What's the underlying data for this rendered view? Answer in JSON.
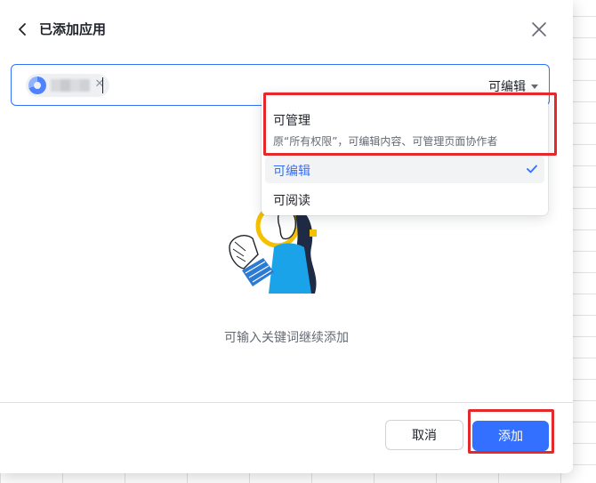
{
  "dialog": {
    "title": "已添加应用",
    "icons": {
      "back": "chevron-left-icon",
      "close": "close-icon"
    }
  },
  "search": {
    "selected_chip": {
      "icon": "app-avatar-icon",
      "label_redacted": true
    },
    "permission_selected": "可编辑"
  },
  "dropdown": {
    "items": [
      {
        "label": "可管理",
        "description": "原“所有权限”，可编辑内容、可管理页面协作者",
        "selected": false
      },
      {
        "label": "可编辑",
        "description": "",
        "selected": true
      },
      {
        "label": "可阅读",
        "description": "",
        "selected": false
      }
    ]
  },
  "empty_state": {
    "hint": "可输入关键词继续添加"
  },
  "footer": {
    "cancel_label": "取消",
    "add_label": "添加"
  },
  "colors": {
    "primary": "#3370ff",
    "highlight": "#e5292a",
    "text": "#1f2329",
    "muted": "#646a73"
  }
}
